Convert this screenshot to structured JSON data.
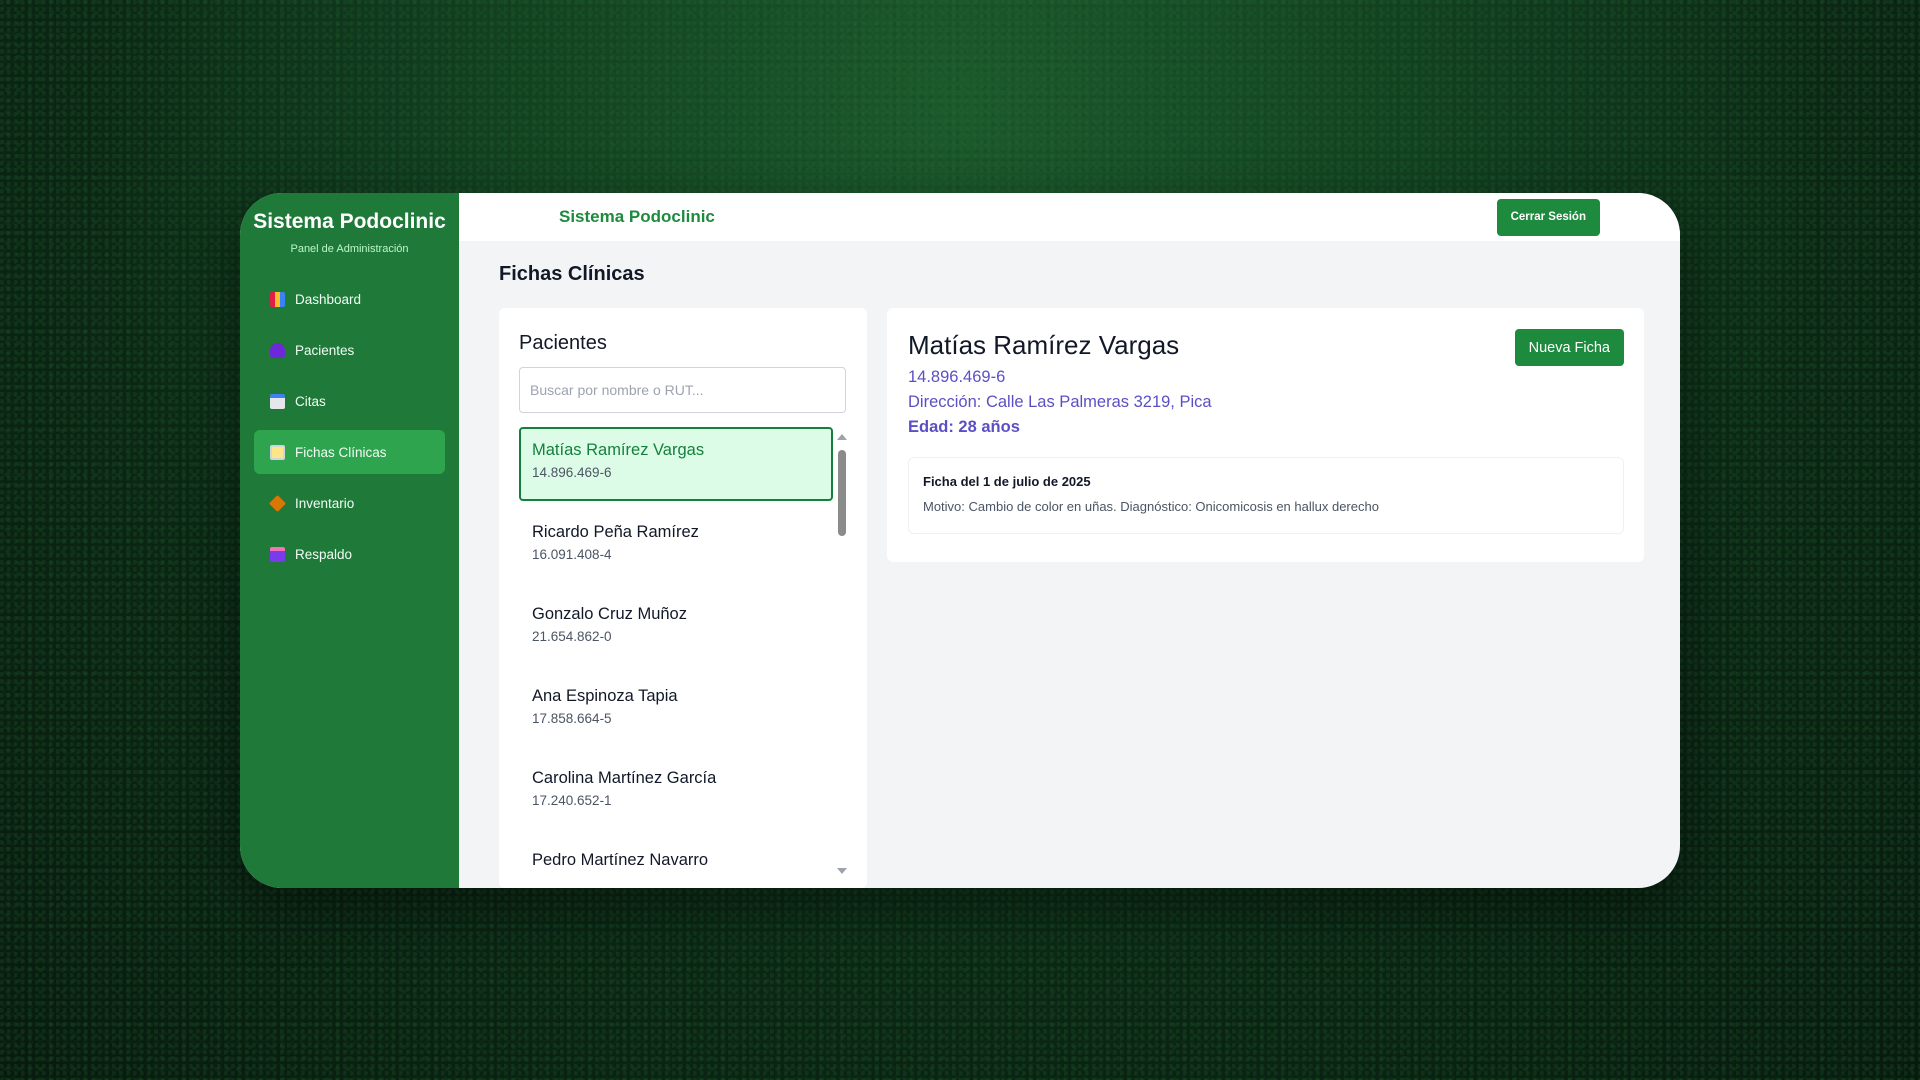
{
  "sidebar": {
    "title": "Sistema Podoclinic",
    "subtitle": "Panel de Administración",
    "items": [
      {
        "label": "Dashboard",
        "icon": "chart-icon"
      },
      {
        "label": "Pacientes",
        "icon": "users-icon"
      },
      {
        "label": "Citas",
        "icon": "calendar-icon"
      },
      {
        "label": "Fichas Clínicas",
        "icon": "clipboard-icon",
        "active": true
      },
      {
        "label": "Inventario",
        "icon": "box-icon"
      },
      {
        "label": "Respaldo",
        "icon": "floppy-disk-icon"
      }
    ]
  },
  "header": {
    "title": "Sistema Podoclinic",
    "logout_label": "Cerrar Sesión"
  },
  "page": {
    "title": "Fichas Clínicas"
  },
  "patients": {
    "heading": "Pacientes",
    "search_placeholder": "Buscar por nombre o RUT...",
    "list": [
      {
        "name": "Matías Ramírez Vargas",
        "rut": "14.896.469-6",
        "selected": true
      },
      {
        "name": "Ricardo Peña Ramírez",
        "rut": "16.091.408-4"
      },
      {
        "name": "Gonzalo Cruz Muñoz",
        "rut": "21.654.862-0"
      },
      {
        "name": "Ana Espinoza Tapia",
        "rut": "17.858.664-5"
      },
      {
        "name": "Carolina Martínez García",
        "rut": "17.240.652-1"
      },
      {
        "name": "Pedro Martínez Navarro",
        "rut": ""
      }
    ]
  },
  "detail": {
    "name": "Matías Ramírez Vargas",
    "rut": "14.896.469-6",
    "address": "Dirección: Calle Las Palmeras 3219, Pica",
    "age": "Edad: 28 años",
    "new_record_label": "Nueva Ficha",
    "records": [
      {
        "title": "Ficha del 1 de julio de 2025",
        "description": "Motivo: Cambio de color en uñas. Diagnóstico: Onicomicosis en hallux derecho"
      }
    ]
  },
  "colors": {
    "sidebar_bg": "#1f7a3a",
    "accent": "#1e8a3e",
    "active_item": "#2ea44f",
    "detail_text": "#5b4fc4"
  }
}
